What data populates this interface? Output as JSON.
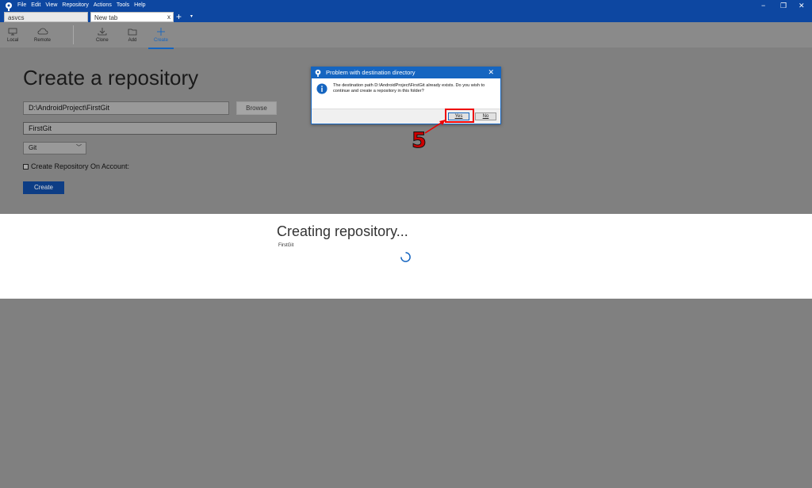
{
  "app": {
    "menu": [
      "File",
      "Edit",
      "View",
      "Repository",
      "Actions",
      "Tools",
      "Help"
    ],
    "window_controls": {
      "minimize": "−",
      "restore": "❐",
      "close": "✕"
    }
  },
  "tabs": [
    {
      "label": "asvcs"
    },
    {
      "label": "New tab",
      "close": "x"
    }
  ],
  "tab_add": "+",
  "tab_menu": "▾",
  "toolbar": {
    "local": "Local",
    "remote": "Remote",
    "clone": "Clone",
    "add": "Add",
    "create": "Create"
  },
  "create_page": {
    "title": "Create a repository",
    "path_value": "D:\\AndroidProject\\FirstGit",
    "browse_label": "Browse",
    "name_value": "FirstGit",
    "vcs_value": "Git",
    "checkbox_label": "Create Repository On Account:",
    "create_label": "Create"
  },
  "progress": {
    "title": "Creating repository...",
    "subtitle": "FirstGit"
  },
  "dialog": {
    "title": "Problem with destination directory",
    "close": "✕",
    "message": "The destination path D:\\AndroidProject\\FirstGit already exists. Do you wish to continue and create a repository in this folder?",
    "yes_label": "Yes",
    "no_label": "No"
  },
  "annotation": {
    "step": "5"
  },
  "colors": {
    "titlebar": "#0d47a1",
    "accent": "#1565c0",
    "annotation_red": "#e00000"
  }
}
